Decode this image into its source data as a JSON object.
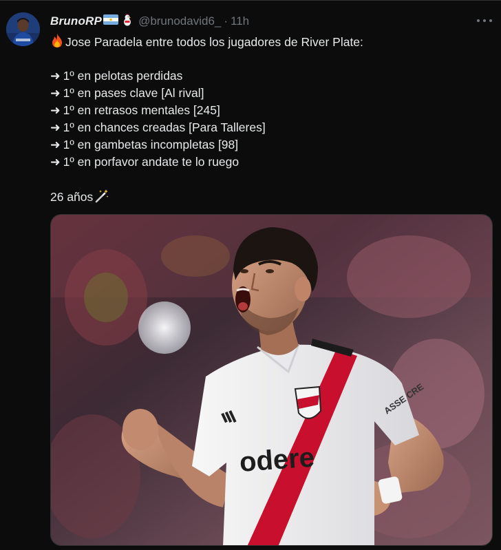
{
  "tweet": {
    "display_name": "BrunoRP",
    "handle": "@brunodavid6_",
    "separator": "·",
    "time": "11h",
    "text": {
      "intro": "Jose Paradela entre todos los jugadores de River Plate:",
      "items": [
        "1º en pelotas perdidas",
        "1º en pases clave [Al rival]",
        "1º en retrasos mentales [245]",
        "1º en chances creadas [Para Talleres]",
        "1º en gambetas incompletas [98]",
        "1º en porfavor andate te lo ruego"
      ],
      "closing": "26 años",
      "arrow": "➜"
    },
    "image": {
      "jersey_sponsor": "odere",
      "sleeve_text": "ASSE CRE"
    }
  },
  "colors": {
    "background": "#0c0c0c",
    "text": "#e7e9ea",
    "muted": "#71767b",
    "jersey_red": "#c8102e",
    "avatar_blue": "#1d3b73"
  },
  "icons": {
    "flag": "argentina-flag-icon",
    "mascot": "chicken-icon",
    "intro": "fire-emoji-icon",
    "closing": "magic-wand-emoji-icon",
    "menu": "more-dots-icon"
  }
}
